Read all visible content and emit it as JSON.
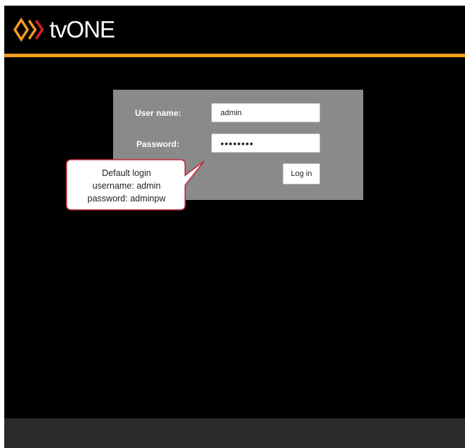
{
  "header": {
    "brand_text": "tvONE",
    "logo_icon": "tvone-chevron-logo-icon",
    "accent_color": "#f39a1c"
  },
  "login": {
    "username_label": "User name:",
    "password_label": "Password:",
    "username_value": "admin",
    "password_value": "••••••••",
    "login_button_label": "Log in"
  },
  "callout": {
    "lines": [
      "Default login",
      "username: admin",
      "password: adminpw"
    ],
    "border_color": "#c0273d"
  }
}
